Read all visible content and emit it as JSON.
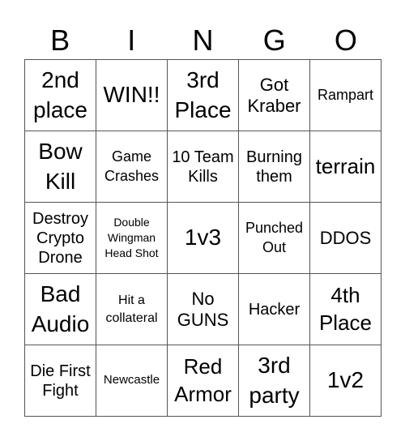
{
  "header": [
    "B",
    "I",
    "N",
    "G",
    "O"
  ],
  "cells": [
    "2nd place",
    "WIN!!",
    "3rd Place",
    "Got Kraber",
    "Rampart",
    "Bow Kill",
    "Game Crashes",
    "10 Team Kills",
    "Burning them",
    "terrain",
    "Destroy Crypto Drone",
    "Double Wingman Head Shot",
    "1v3",
    "Punched Out",
    "DDOS",
    "Bad Audio",
    "Hit a collateral",
    "No GUNS",
    "Hacker",
    "4th Place",
    "Die First Fight",
    "Newcastle",
    "Red Armor",
    "3rd party",
    "1v2"
  ]
}
